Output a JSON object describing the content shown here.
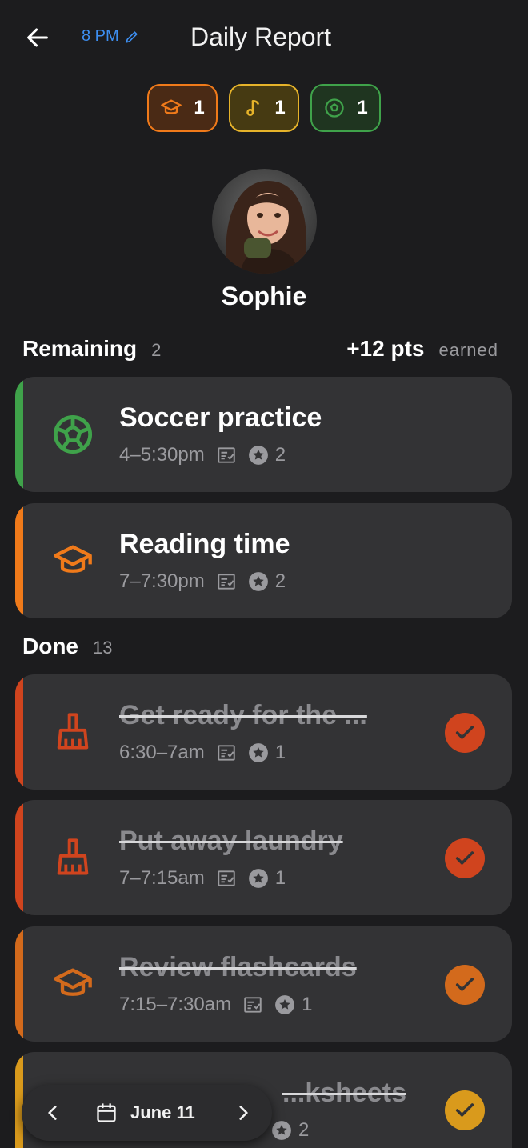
{
  "header": {
    "time": "8 PM",
    "title": "Daily Report"
  },
  "badges": [
    {
      "icon": "graduation-cap-icon",
      "count": "1",
      "color": "#f07a1a",
      "bg": "#4a2a15"
    },
    {
      "icon": "music-note-icon",
      "count": "1",
      "color": "#e6b32a",
      "bg": "#463a12"
    },
    {
      "icon": "soccer-ball-icon",
      "count": "1",
      "color": "#3fa24a",
      "bg": "#1f3520"
    }
  ],
  "profile": {
    "name": "Sophie"
  },
  "remaining": {
    "label": "Remaining",
    "count": "2",
    "points": "+12 pts",
    "points_suffix": "earned"
  },
  "remaining_tasks": [
    {
      "name": "Soccer practice",
      "time": "4–5:30pm",
      "points": "2",
      "icon": "soccer-ball-icon",
      "color": "#3fa24a"
    },
    {
      "name": "Reading time",
      "time": "7–7:30pm",
      "points": "2",
      "icon": "graduation-cap-icon",
      "color": "#f07a1a"
    }
  ],
  "done": {
    "label": "Done",
    "count": "13"
  },
  "done_tasks": [
    {
      "name": "Get ready for the ...",
      "time": "6:30–7am",
      "points": "1",
      "icon": "broom-icon",
      "color": "#d0441e"
    },
    {
      "name": "Put away laundry",
      "time": "7–7:15am",
      "points": "1",
      "icon": "broom-icon",
      "color": "#d0441e"
    },
    {
      "name": "Review flashcards",
      "time": "7:15–7:30am",
      "points": "1",
      "icon": "graduation-cap-icon",
      "color": "#d36a1c"
    },
    {
      "name": "...ksheets",
      "time": "",
      "points": "2",
      "icon": "graduation-cap-icon",
      "color": "#d99a1c"
    }
  ],
  "date_nav": {
    "date": "June 11"
  }
}
